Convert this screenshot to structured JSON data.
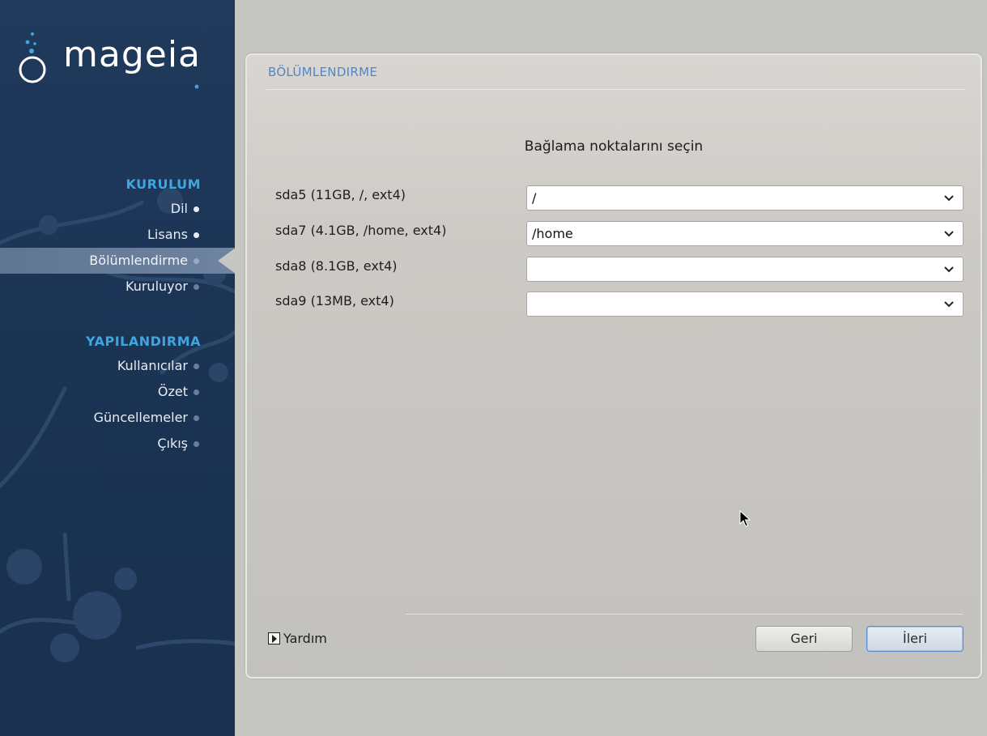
{
  "brand": {
    "logo_text": "mageia"
  },
  "sidebar": {
    "sections": [
      {
        "title": "KURULUM",
        "items": [
          {
            "label": "Dil",
            "state": "done"
          },
          {
            "label": "Lisans",
            "state": "done"
          },
          {
            "label": "Bölümlendirme",
            "state": "active"
          },
          {
            "label": "Kuruluyor",
            "state": "pending"
          }
        ]
      },
      {
        "title": "YAPILANDIRMA",
        "items": [
          {
            "label": "Kullanıcılar",
            "state": "pending"
          },
          {
            "label": "Özet",
            "state": "pending"
          },
          {
            "label": "Güncellemeler",
            "state": "pending"
          },
          {
            "label": "Çıkış",
            "state": "pending"
          }
        ]
      }
    ]
  },
  "main": {
    "title": "BÖLÜMLENDIRME",
    "subtitle": "Bağlama noktalarını seçin",
    "partitions": [
      {
        "label": "sda5 (11GB, /, ext4)",
        "mount": "/"
      },
      {
        "label": "sda7 (4.1GB, /home, ext4)",
        "mount": "/home"
      },
      {
        "label": "sda8 (8.1GB, ext4)",
        "mount": ""
      },
      {
        "label": "sda9 (13MB, ext4)",
        "mount": ""
      }
    ],
    "help_label": "Yardım",
    "back_label": "Geri",
    "next_label": "İleri"
  },
  "colors": {
    "sidebar_bg": "#1d3556",
    "section_title": "#3ea6e0",
    "panel_title": "#4f86c8",
    "active_item_bg": "#6a809c"
  },
  "icons": [
    "mageia-logo",
    "chevron-down-icon",
    "expander-arrow-icon",
    "mouse-pointer-icon"
  ]
}
